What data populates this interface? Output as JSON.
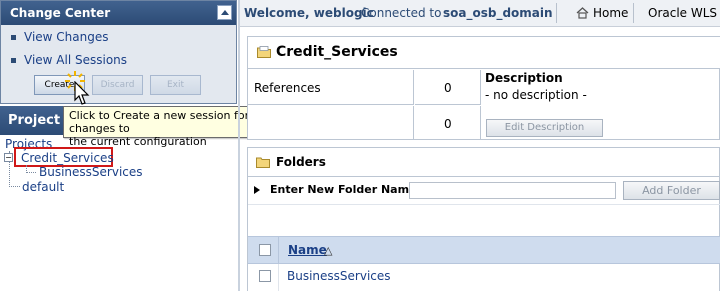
{
  "change_center": {
    "title": "Change Center",
    "links": [
      "View Changes",
      "View All Sessions"
    ],
    "buttons": {
      "create": "Create",
      "discard": "Discard",
      "exit": "Exit"
    }
  },
  "tooltip": {
    "line1": "Click to Create a new session for making changes to",
    "line2": "the current configuration"
  },
  "project_explorer": {
    "title": "Project E",
    "root": "Projects",
    "items": [
      "Credit_Services",
      "BusinessServices",
      "default"
    ]
  },
  "topbar": {
    "welcome": "Welcome, weblogic",
    "connected_label": "Connected to :",
    "domain": "soa_osb_domain",
    "home": "Home",
    "oracle": "Oracle WLS C"
  },
  "project": {
    "title": "Credit_Services",
    "references_label": "References",
    "references_count": "0",
    "row2_count": "0",
    "description_label": "Description",
    "description_value": "- no description -",
    "edit_description": "Edit Description"
  },
  "folders": {
    "title": "Folders",
    "new_folder_label": "Enter New Folder Name:",
    "new_folder_value": "",
    "add_folder": "Add Folder",
    "column_name": "Name",
    "sort_indicator": "△",
    "rows": [
      "BusinessServices"
    ]
  },
  "colors": {
    "header_blue": "#2c4b75",
    "link_blue": "#1a3f86",
    "highlight_red": "#d01818",
    "tooltip_bg": "#ffffe1"
  }
}
